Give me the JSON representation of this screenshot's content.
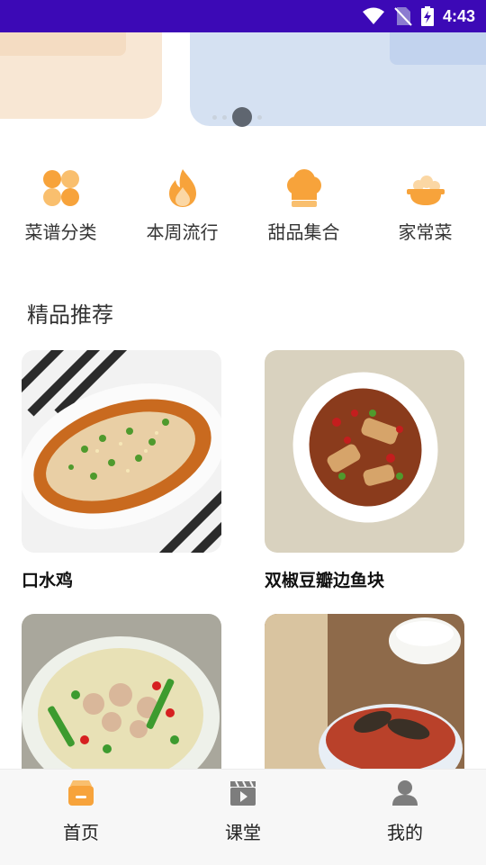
{
  "status_bar": {
    "time": "4:43",
    "icons": [
      "wifi-icon",
      "no-sim-icon",
      "battery-charging-icon"
    ]
  },
  "banner": {
    "page_count": 4,
    "active_index": 1
  },
  "categories": [
    {
      "label": "菜谱分类",
      "icon": "four-petal-icon"
    },
    {
      "label": "本周流行",
      "icon": "flame-icon"
    },
    {
      "label": "甜品集合",
      "icon": "chef-hat-icon"
    },
    {
      "label": "家常菜",
      "icon": "food-bowl-icon"
    }
  ],
  "section": {
    "title": "精品推荐"
  },
  "recipes": [
    {
      "name": "口水鸡"
    },
    {
      "name": "双椒豆瓣边鱼块"
    },
    {
      "name": ""
    },
    {
      "name": ""
    }
  ],
  "tabs": [
    {
      "label": "首页",
      "icon": "home-box-icon",
      "active": true,
      "color": "#f7a33b"
    },
    {
      "label": "课堂",
      "icon": "video-clapper-icon",
      "active": false,
      "color": "#7d7d7d"
    },
    {
      "label": "我的",
      "icon": "user-icon",
      "active": false,
      "color": "#7d7d7d"
    }
  ],
  "colors": {
    "status_bar": "#3c09b6",
    "accent": "#f7a33b"
  }
}
